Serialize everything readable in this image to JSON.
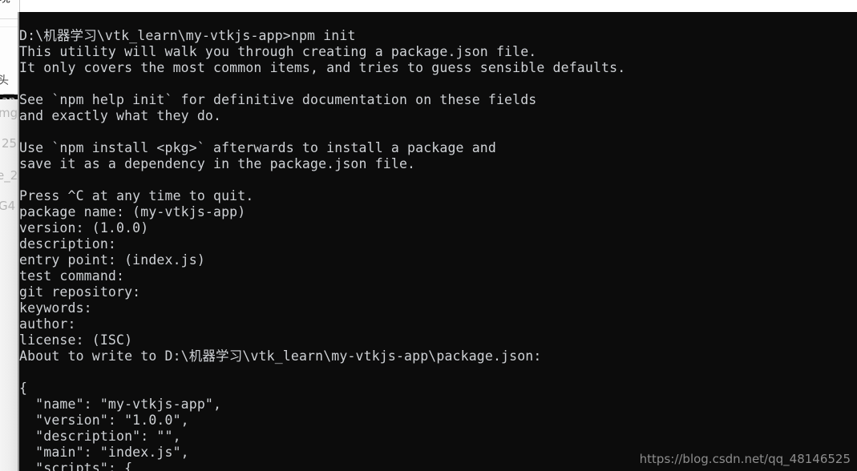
{
  "background_window": {
    "title_fragment": "境",
    "side_char_fragment": "头",
    "list_fragments": [
      {
        "text": "-an"
      },
      {
        "text": "mg"
      },
      {
        "text": "25"
      },
      {
        "text": "e_2"
      },
      {
        "text": "G4"
      }
    ]
  },
  "terminal": {
    "background_color": "#0c0c0c",
    "text_color": "#cfd2d6",
    "prompt_path": "D:\\机器学习\\vtk_learn\\my-vtkjs-app",
    "command": "npm init",
    "lines": [
      "D:\\机器学习\\vtk_learn\\my-vtkjs-app>npm init",
      "This utility will walk you through creating a package.json file.",
      "It only covers the most common items, and tries to guess sensible defaults.",
      "",
      "See `npm help init` for definitive documentation on these fields",
      "and exactly what they do.",
      "",
      "Use `npm install <pkg>` afterwards to install a package and",
      "save it as a dependency in the package.json file.",
      "",
      "Press ^C at any time to quit.",
      "package name: (my-vtkjs-app)",
      "version: (1.0.0)",
      "description:",
      "entry point: (index.js)",
      "test command:",
      "git repository:",
      "keywords:",
      "author:",
      "license: (ISC)",
      "About to write to D:\\机器学习\\vtk_learn\\my-vtkjs-app\\package.json:",
      "",
      "{",
      "  \"name\": \"my-vtkjs-app\",",
      "  \"version\": \"1.0.0\",",
      "  \"description\": \"\",",
      "  \"main\": \"index.js\",",
      "  \"scripts\": {"
    ],
    "prompts": [
      {
        "label": "package name:",
        "default": "(my-vtkjs-app)"
      },
      {
        "label": "version:",
        "default": "(1.0.0)"
      },
      {
        "label": "description:",
        "default": ""
      },
      {
        "label": "entry point:",
        "default": "(index.js)"
      },
      {
        "label": "test command:",
        "default": ""
      },
      {
        "label": "git repository:",
        "default": ""
      },
      {
        "label": "keywords:",
        "default": ""
      },
      {
        "label": "author:",
        "default": ""
      },
      {
        "label": "license:",
        "default": "(ISC)"
      }
    ],
    "package_json_preview": {
      "name": "my-vtkjs-app",
      "version": "1.0.0",
      "description": "",
      "main": "index.js",
      "scripts": "{"
    }
  },
  "watermark": {
    "text": "https://blog.csdn.net/qq_48146525"
  }
}
